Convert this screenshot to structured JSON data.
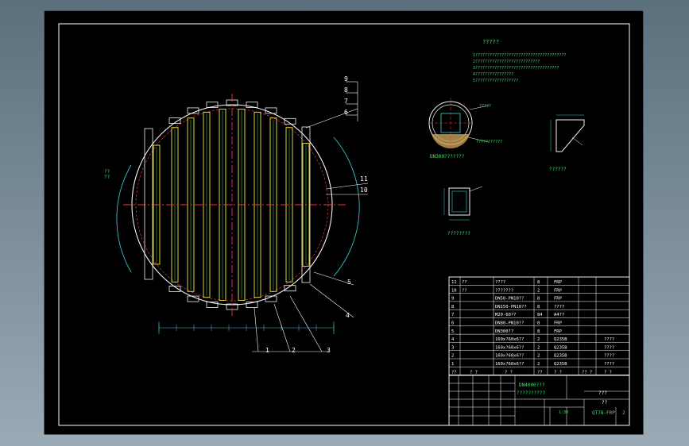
{
  "notes": {
    "title": "?????",
    "lines": [
      "1??????????????????????????????????????",
      "2???????????????????????????",
      "3???????????????????????????????????",
      "4????????????????",
      "5??????????????????"
    ]
  },
  "main_view": {
    "callouts": [
      "9",
      "8",
      "7",
      "6",
      "11",
      "10",
      "5",
      "4",
      "3",
      "2",
      "1"
    ],
    "side_labels": [
      "??",
      "??"
    ]
  },
  "details": {
    "pipe_caption": "DN300???????",
    "channel_caption": "????????",
    "angle_caption": "??????",
    "pipe_note_1": "?????",
    "pipe_note_2": "???????????"
  },
  "bom": {
    "rows": [
      {
        "no": "11",
        "name": "??",
        "spec": "????",
        "qty": "8",
        "material": "FRP"
      },
      {
        "no": "10",
        "name": "??",
        "spec": "???????",
        "qty": "2",
        "material": "FRP"
      },
      {
        "no": "9",
        "name": "",
        "spec": "DN50-PN10??",
        "qty": "8",
        "material": "FRP"
      },
      {
        "no": "8",
        "name": "",
        "spec": "DN150-PN10??",
        "qty": "8",
        "material": "????"
      },
      {
        "no": "7",
        "name": "",
        "spec": "M20-60??",
        "qty": "84",
        "material": "A4??"
      },
      {
        "no": "6",
        "name": "",
        "spec": "DN80-PN10??",
        "qty": "8",
        "material": "FRP"
      },
      {
        "no": "5",
        "name": "",
        "spec": "DN300??",
        "qty": "8",
        "material": "FRP"
      },
      {
        "no": "4",
        "name": "",
        "spec": "160x?60x6??",
        "qty": "2",
        "material": "Q235B",
        "note": "????"
      },
      {
        "no": "3",
        "name": "",
        "spec": "160x?60x6??",
        "qty": "2",
        "material": "Q235B",
        "note": "????"
      },
      {
        "no": "2",
        "name": "",
        "spec": "160x?60x6??",
        "qty": "2",
        "material": "Q235B",
        "note": "????"
      },
      {
        "no": "1",
        "name": "",
        "spec": "160x?60x6??",
        "qty": "2",
        "material": "Q235B",
        "note": "????"
      }
    ],
    "header": {
      "no": "??",
      "name": "? ?",
      "spec": "? ?",
      "qty": "??",
      "material": "? ?",
      "note1": "?? ?",
      "note2": "? ?"
    }
  },
  "title_block": {
    "drawing_name_1": "DN4000???",
    "drawing_name_2": "??????????",
    "code": "QT78-FRP",
    "sheet": "2",
    "scale": "1:30",
    "unit_1": "???",
    "unit_2": "??"
  }
}
